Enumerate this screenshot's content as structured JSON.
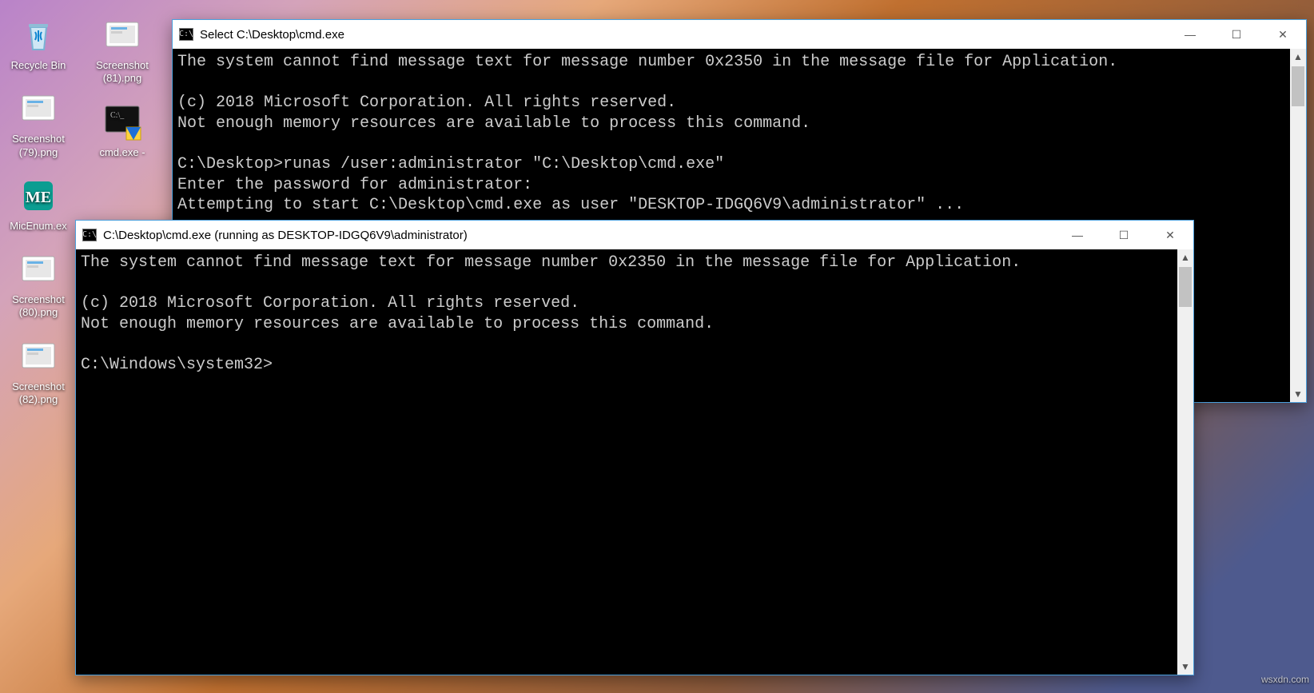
{
  "desktop": {
    "col1": [
      {
        "name": "recycle-bin",
        "label": "Recycle Bin"
      },
      {
        "name": "screenshot-79",
        "label": "Screenshot (79).png"
      },
      {
        "name": "micenum",
        "label": "MicEnum.ex"
      },
      {
        "name": "screenshot-80",
        "label": "Screenshot (80).png"
      },
      {
        "name": "screenshot-82",
        "label": "Screenshot (82).png"
      }
    ],
    "col2": [
      {
        "name": "screenshot-81",
        "label": "Screenshot (81).png"
      },
      {
        "name": "cmd-shortcut",
        "label": "cmd.exe -"
      }
    ]
  },
  "window1": {
    "title": "Select C:\\Desktop\\cmd.exe",
    "lines": [
      "The system cannot find message text for message number 0x2350 in the message file for Application.",
      "",
      "(c) 2018 Microsoft Corporation. All rights reserved.",
      "Not enough memory resources are available to process this command.",
      "",
      "C:\\Desktop>runas /user:administrator \"C:\\Desktop\\cmd.exe\"",
      "Enter the password for administrator:",
      "Attempting to start C:\\Desktop\\cmd.exe as user \"DESKTOP-IDGQ6V9\\administrator\" ..."
    ]
  },
  "window2": {
    "title": "C:\\Desktop\\cmd.exe (running as DESKTOP-IDGQ6V9\\administrator)",
    "lines": [
      "The system cannot find message text for message number 0x2350 in the message file for Application.",
      "",
      "(c) 2018 Microsoft Corporation. All rights reserved.",
      "Not enough memory resources are available to process this command.",
      "",
      "C:\\Windows\\system32>"
    ]
  },
  "controls": {
    "min": "—",
    "max": "☐",
    "close": "✕"
  },
  "cmdicon": "C:\\",
  "watermark": "wsxdn.com"
}
